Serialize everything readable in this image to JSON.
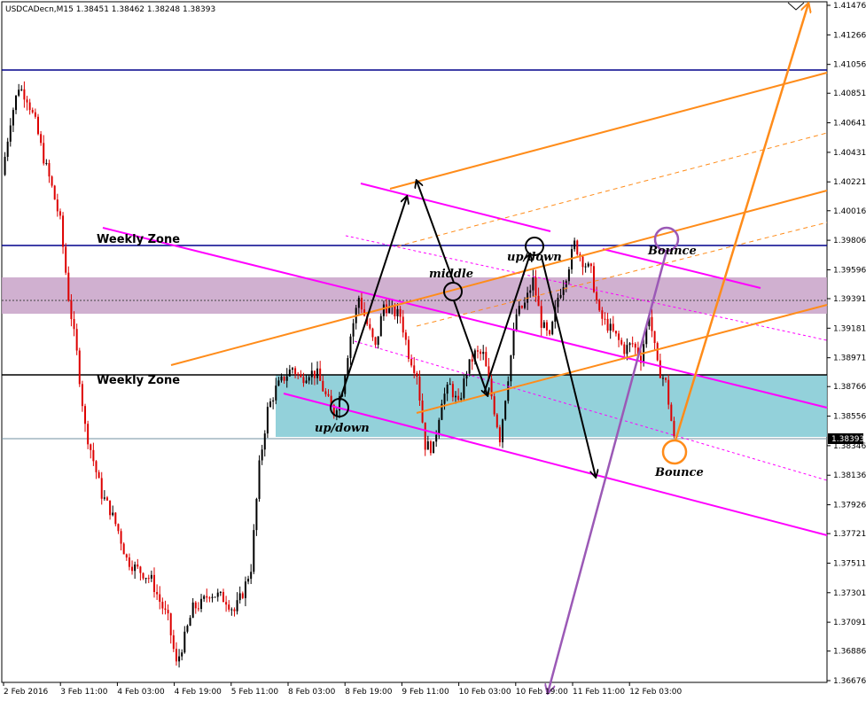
{
  "chart_data": {
    "type": "candlestick",
    "title": "USDCADecn,M15  1.38451 1.38462 1.38248 1.38393",
    "symbol": "USDCADecn",
    "timeframe": "M15",
    "ohlc_last": {
      "open": 1.38451,
      "high": 1.38462,
      "low": 1.38248,
      "close": 1.38393
    },
    "current_price_label": "1.38393",
    "y_axis": {
      "ticks": [
        "1.41476",
        "1.41266",
        "1.41056",
        "1.40851",
        "1.40641",
        "1.40431",
        "1.40221",
        "1.40016",
        "1.39806",
        "1.39596",
        "1.39391",
        "1.39181",
        "1.38971",
        "1.38766",
        "1.38556",
        "1.38346",
        "1.38136",
        "1.37926",
        "1.37721",
        "1.37511",
        "1.37301",
        "1.37091",
        "1.36886",
        "1.36676"
      ],
      "range": [
        1.3662,
        1.4156
      ]
    },
    "x_axis": {
      "ticks": [
        "2 Feb 2016",
        "3 Feb 11:00",
        "4 Feb 03:00",
        "4 Feb 19:00",
        "5 Feb 11:00",
        "8 Feb 03:00",
        "8 Feb 19:00",
        "9 Feb 11:00",
        "10 Feb 03:00",
        "10 Feb 19:00",
        "11 Feb 11:00",
        "12 Feb 03:00"
      ]
    },
    "price_path": [
      [
        0,
        1.4027
      ],
      [
        1,
        1.4066
      ],
      [
        2,
        1.409
      ],
      [
        3,
        1.4082
      ],
      [
        4,
        1.4064
      ],
      [
        5,
        1.4039
      ],
      [
        6,
        1.4018
      ],
      [
        7,
        1.3994
      ],
      [
        8,
        1.394
      ],
      [
        9,
        1.39
      ],
      [
        10,
        1.3848
      ],
      [
        11,
        1.3824
      ],
      [
        12,
        1.38
      ],
      [
        13,
        1.3789
      ],
      [
        14,
        1.3774
      ],
      [
        15,
        1.3754
      ],
      [
        16,
        1.3748
      ],
      [
        17,
        1.3744
      ],
      [
        18,
        1.3739
      ],
      [
        19,
        1.3724
      ],
      [
        20,
        1.3711
      ],
      [
        21,
        1.3679
      ],
      [
        22,
        1.3698
      ],
      [
        23,
        1.3719
      ],
      [
        24,
        1.3722
      ],
      [
        25,
        1.373
      ],
      [
        26,
        1.3728
      ],
      [
        27,
        1.3725
      ],
      [
        28,
        1.3717
      ],
      [
        29,
        1.373
      ],
      [
        30,
        1.3748
      ],
      [
        31,
        1.382
      ],
      [
        32,
        1.386
      ],
      [
        33,
        1.3875
      ],
      [
        34,
        1.3883
      ],
      [
        35,
        1.389
      ],
      [
        36,
        1.3882
      ],
      [
        37,
        1.3887
      ],
      [
        38,
        1.3885
      ],
      [
        39,
        1.387
      ],
      [
        40,
        1.3858
      ],
      [
        41,
        1.3875
      ],
      [
        42,
        1.3913
      ],
      [
        43,
        1.394
      ],
      [
        44,
        1.3921
      ],
      [
        45,
        1.3904
      ],
      [
        46,
        1.3935
      ],
      [
        47,
        1.393
      ],
      [
        48,
        1.3927
      ],
      [
        49,
        1.39
      ],
      [
        50,
        1.3886
      ],
      [
        51,
        1.3835
      ],
      [
        52,
        1.3833
      ],
      [
        53,
        1.3868
      ],
      [
        54,
        1.3877
      ],
      [
        55,
        1.3863
      ],
      [
        56,
        1.3888
      ],
      [
        57,
        1.39
      ],
      [
        58,
        1.3899
      ],
      [
        59,
        1.387
      ],
      [
        60,
        1.384
      ],
      [
        61,
        1.3884
      ],
      [
        62,
        1.3928
      ],
      [
        63,
        1.3935
      ],
      [
        64,
        1.3952
      ],
      [
        65,
        1.3922
      ],
      [
        66,
        1.391
      ],
      [
        67,
        1.394
      ],
      [
        68,
        1.3956
      ],
      [
        69,
        1.3978
      ],
      [
        70,
        1.3966
      ],
      [
        71,
        1.3958
      ],
      [
        72,
        1.3927
      ],
      [
        73,
        1.392
      ],
      [
        74,
        1.3912
      ],
      [
        75,
        1.3903
      ],
      [
        76,
        1.3907
      ],
      [
        77,
        1.3897
      ],
      [
        78,
        1.3929
      ],
      [
        79,
        1.3891
      ],
      [
        80,
        1.3879
      ],
      [
        81,
        1.3839
      ]
    ],
    "price_path_x_unit": "bar index (approx. 12 bars per labelled date step)",
    "horizontal_levels": [
      {
        "value": 1.4103,
        "color": "#00008b"
      },
      {
        "value": 1.39806,
        "color": "#00008b",
        "label": "Weekly  Zone"
      },
      {
        "value": 1.3937,
        "color": "#555555",
        "dashed": true
      },
      {
        "value": 1.38813,
        "color": "#000000",
        "label": "Weekly  Zone"
      },
      {
        "value": 1.38393,
        "color": "#7090a0"
      }
    ],
    "zones": [
      {
        "from": 1.39107,
        "to": 1.39562,
        "color": "#c8a2c8"
      },
      {
        "from": 1.38433,
        "to": 1.38813,
        "color": "#80c9d3"
      }
    ],
    "annotations": {
      "weekly_zone_upper": "Weekly  Zone",
      "weekly_zone_lower": "Weekly  Zone",
      "up_down_left": "up/down",
      "up_down_right": "up/down",
      "middle": "middle",
      "bounce_upper": "Bounce",
      "bounce_lower": "Bounce"
    },
    "colors": {
      "up": "#000000",
      "down": "#dd0000",
      "channel_magenta": "#ff00ff",
      "channel_orange": "#ff8c1a",
      "projection_purple": "#9b59b6",
      "projection_orange": "#ff8c1a"
    }
  }
}
